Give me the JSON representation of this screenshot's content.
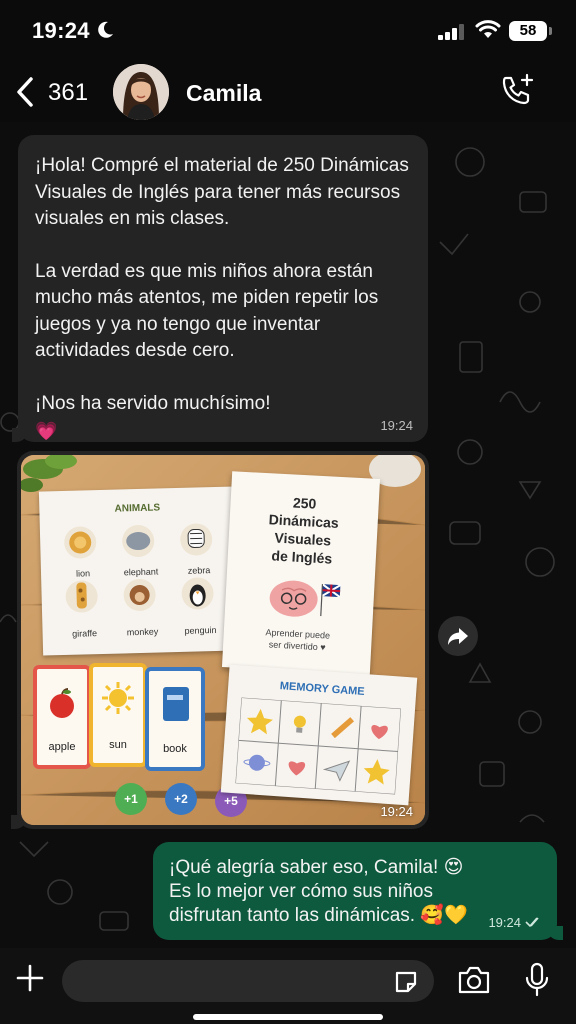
{
  "status_bar": {
    "time": "19:24",
    "battery": "58",
    "icons": [
      "moon-icon",
      "signal-icon",
      "wifi-icon",
      "battery-icon"
    ]
  },
  "header": {
    "back_count": "361",
    "contact_name": "Camila",
    "icons": [
      "chevron-left-icon",
      "avatar",
      "phone-add-icon"
    ]
  },
  "messages": [
    {
      "direction": "incoming",
      "paragraphs": [
        "¡Hola! Compré el material de 250 Dinámicas Visuales de Inglés para tener más recursos visuales en mis clases.",
        "La verdad es que mis niños ahora están mucho más atentos, me piden repetir los juegos y ya no tengo que inventar actividades desde cero.",
        "¡Nos ha servido muchísimo!"
      ],
      "emoji": "💗",
      "time": "19:24"
    },
    {
      "direction": "incoming",
      "type": "image",
      "time": "19:24",
      "image": {
        "animals_title": "ANIMALS",
        "animals": [
          "lion",
          "elephant",
          "zebra",
          "giraffe",
          "monkey",
          "penguin"
        ],
        "book_title_lines": [
          "250",
          "Dinámicas",
          "Visuales",
          "de Inglés"
        ],
        "book_tagline_lines": [
          "Aprender puede",
          "ser divertido ♥"
        ],
        "flashcards": [
          "apple",
          "sun",
          "book"
        ],
        "tokens": [
          "+1",
          "+2",
          "+5"
        ],
        "memory_title": "MEMORY GAME"
      }
    },
    {
      "direction": "outgoing",
      "lines": [
        "¡Qué alegría saber eso, Camila! 😍",
        "Es lo mejor ver cómo sus niños",
        "disfrutan tanto las dinámicas. 🥰💛"
      ],
      "time": "19:24",
      "status": "read"
    }
  ],
  "input": {
    "placeholder": "",
    "icons": [
      "plus-icon",
      "sticker-icon",
      "camera-icon",
      "microphone-icon"
    ]
  },
  "colors": {
    "background": "#0b0b0b",
    "incoming_bubble": "#242424",
    "outgoing_bubble": "#0e5a3f",
    "input_field": "#2a2a2a"
  }
}
